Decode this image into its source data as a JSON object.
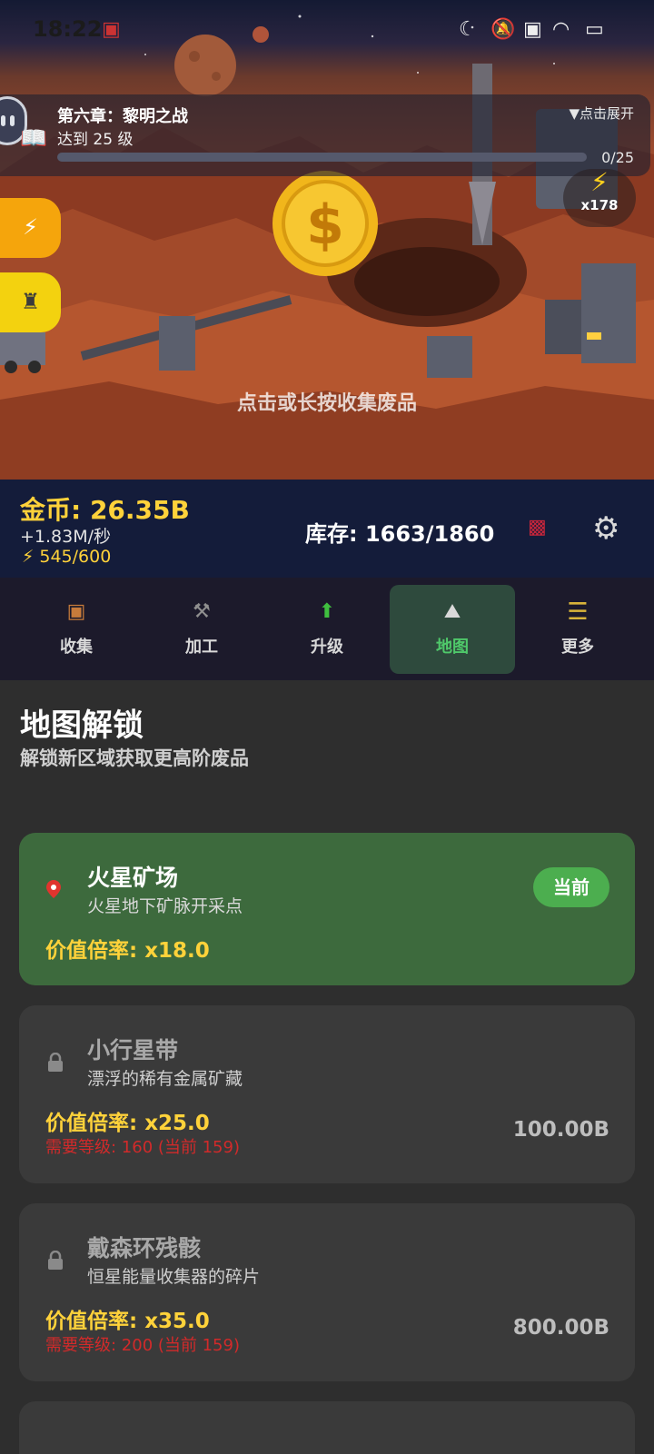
{
  "status": {
    "time": "18:22"
  },
  "quest": {
    "title": "第六章：黎明之战",
    "subtitle": "达到 25 级",
    "expand": "▼点击展开",
    "progress_text": "0/25",
    "progress": 0.0
  },
  "energy_badge": {
    "multiplier": "x178"
  },
  "scene": {
    "hint": "点击或长按收集废品",
    "icons": [
      "bolt-icon",
      "robot-icon",
      "coin-icon"
    ]
  },
  "resource": {
    "gold": "金币: 26.35B",
    "rate": "+1.83M/秒",
    "energy": "⚡ 545/600",
    "stock": "库存: 1663/1860"
  },
  "tabs": [
    {
      "label": "收集",
      "icon": "chest-icon"
    },
    {
      "label": "加工",
      "icon": "hammer-icon"
    },
    {
      "label": "升级",
      "icon": "up-arrow-icon"
    },
    {
      "label": "地图",
      "icon": "mountain-map-icon",
      "active": true
    },
    {
      "label": "更多",
      "icon": "menu-icon"
    }
  ],
  "map": {
    "title": "地图解锁",
    "subtitle": "解锁新区域获取更高阶废品",
    "zones": [
      {
        "name": "火星矿场",
        "desc": "火星地下矿脉开采点",
        "mult": "价值倍率: x18.0",
        "badge": "当前",
        "status": "current"
      },
      {
        "name": "小行星带",
        "desc": "漂浮的稀有金属矿藏",
        "mult": "价值倍率: x25.0",
        "req": "需要等级: 160 (当前 159)",
        "cost": "100.00B",
        "status": "locked"
      },
      {
        "name": "戴森环残骸",
        "desc": "恒星能量收集器的碎片",
        "mult": "价值倍率: x35.0",
        "req": "需要等级: 200 (当前 159)",
        "cost": "800.00B",
        "status": "locked"
      },
      {
        "name": "",
        "status": "locked"
      }
    ]
  },
  "colors": {
    "gold": "#ffd23a",
    "active_tab": "#4fc96a",
    "current_card": "#3d6a3d",
    "badge": "#4cae4f",
    "error": "#d12a2a"
  }
}
